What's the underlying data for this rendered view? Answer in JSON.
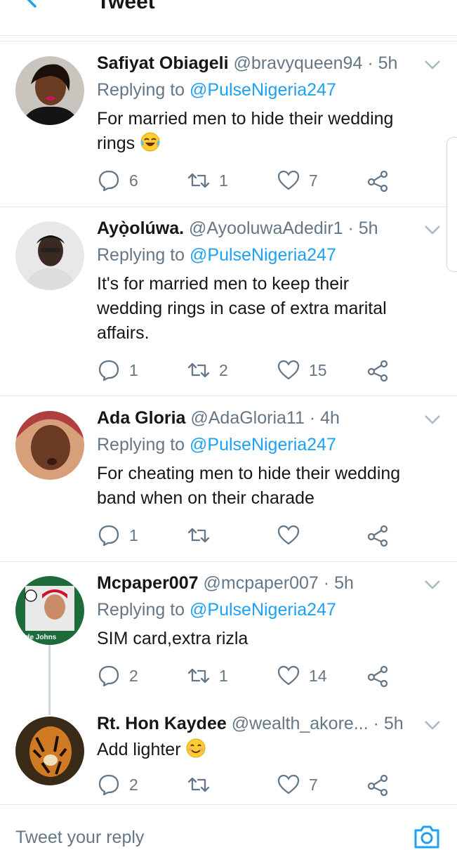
{
  "header": {
    "title": "Tweet"
  },
  "tweets": [
    {
      "name": "Safiyat Obiageli",
      "handle": "@bravyqueen94",
      "time": "· 5h",
      "replying_label": "Replying to",
      "replying_to": "@PulseNigeria247",
      "text_lines": [
        "For married men to hide their wedding",
        "rings"
      ],
      "emoji": "laughing-tears-emoji",
      "replies": "6",
      "retweets": "1",
      "likes": "7"
    },
    {
      "name": "Ayọ̀olúwa.",
      "handle": "@AyooluwaAdedir1",
      "time": "· 5h",
      "replying_label": "Replying to",
      "replying_to": "@PulseNigeria247",
      "text_lines": [
        "It's for married men to keep their",
        "wedding rings in case of extra marital",
        "affairs."
      ],
      "replies": "1",
      "retweets": "2",
      "likes": "15"
    },
    {
      "name": "Ada Gloria",
      "handle": "@AdaGloria11",
      "time": "· 4h",
      "replying_label": "Replying to",
      "replying_to": "@PulseNigeria247",
      "text_lines": [
        "For cheating men to hide their wedding",
        "band when on their charade"
      ],
      "replies": "1",
      "retweets": "",
      "likes": ""
    },
    {
      "name": "Mcpaper007",
      "handle": "@mcpaper007",
      "time": "· 5h",
      "replying_label": "Replying to",
      "replying_to": "@PulseNigeria247",
      "text_lines": [
        "SIM card,extra rizla"
      ],
      "avatar_text": "lade Johns",
      "replies": "2",
      "retweets": "1",
      "likes": "14"
    },
    {
      "name": "Rt. Hon Kaydee",
      "handle": "@wealth_akore...",
      "time": "· 5h",
      "text_lines": [
        "Add lighter"
      ],
      "emoji": "smiling-emoji",
      "replies": "2",
      "retweets": "",
      "likes": "7"
    }
  ],
  "reply_bar": {
    "placeholder": "Tweet your reply"
  },
  "colors": {
    "accent": "#1da1f2",
    "muted": "#657786",
    "divider": "#e1e8ed"
  }
}
